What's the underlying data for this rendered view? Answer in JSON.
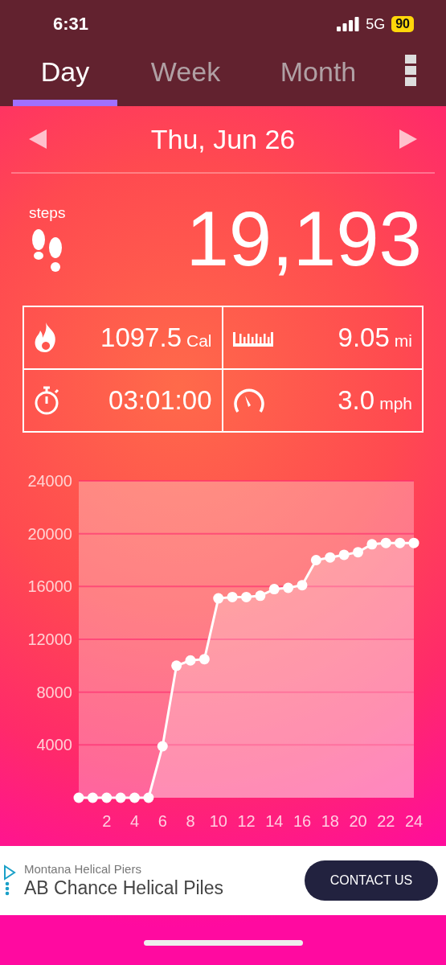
{
  "status_bar": {
    "time": "6:31",
    "network": "5G",
    "battery": "90"
  },
  "tabs": [
    {
      "label": "Day",
      "selected": true
    },
    {
      "label": "Week",
      "selected": false
    },
    {
      "label": "Month",
      "selected": false
    }
  ],
  "date": "Thu, Jun 26",
  "steps": {
    "label": "steps",
    "value": "19,193"
  },
  "stats": [
    {
      "kind": "calories",
      "value": "1097.5",
      "unit": "Cal"
    },
    {
      "kind": "distance",
      "value": "9.05",
      "unit": "mi"
    },
    {
      "kind": "duration",
      "value": "03:01:00"
    },
    {
      "kind": "speed",
      "value": "3.0",
      "unit": "mph"
    }
  ],
  "chart_data": {
    "type": "area",
    "x": [
      0,
      1,
      2,
      3,
      4,
      5,
      6,
      7,
      8,
      9,
      10,
      11,
      12,
      13,
      14,
      15,
      16,
      17,
      18,
      19,
      20,
      21,
      22,
      23,
      24
    ],
    "grid": true,
    "series": [
      {
        "color": "#ffffff",
        "values": [
          0,
          0,
          0,
          0,
          0,
          0,
          3900,
          10000,
          10400,
          10500,
          15100,
          15200,
          15200,
          15300,
          15800,
          15900,
          16100,
          18000,
          18200,
          18400,
          18600,
          19200,
          19300,
          19300,
          19300
        ]
      }
    ],
    "xlim": [
      0,
      24
    ],
    "ylim": [
      0,
      24000
    ],
    "xticks": [
      2,
      4,
      6,
      8,
      10,
      12,
      14,
      16,
      18,
      20,
      22,
      24
    ],
    "yticks": [
      4000,
      8000,
      12000,
      16000,
      20000,
      24000
    ]
  },
  "ad": {
    "advertiser": "Montana Helical Piers",
    "headline": "AB Chance Helical Piles",
    "button": "CONTACT US"
  }
}
